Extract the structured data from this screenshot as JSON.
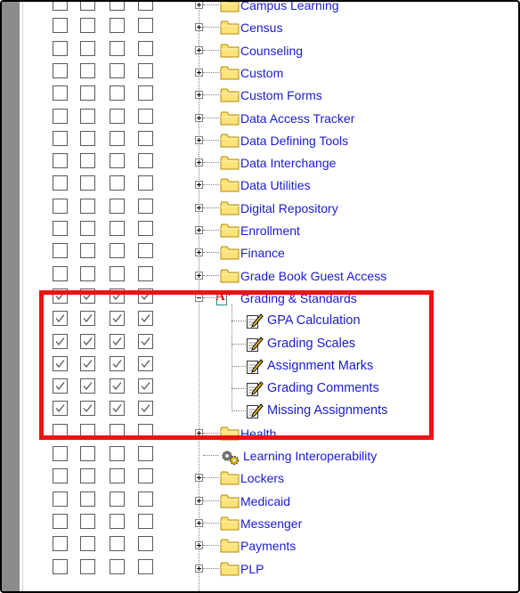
{
  "tree": {
    "rows": [
      {
        "label": "Campus Learning",
        "kind": "folder",
        "expander": "plus",
        "checked": false
      },
      {
        "label": "Census",
        "kind": "folder",
        "expander": "plus",
        "checked": false
      },
      {
        "label": "Counseling",
        "kind": "folder",
        "expander": "plus",
        "checked": false
      },
      {
        "label": "Custom",
        "kind": "folder",
        "expander": "plus",
        "checked": false
      },
      {
        "label": "Custom Forms",
        "kind": "folder",
        "expander": "plus",
        "checked": false
      },
      {
        "label": "Data Access Tracker",
        "kind": "folder",
        "expander": "plus",
        "checked": false
      },
      {
        "label": "Data Defining Tools",
        "kind": "folder",
        "expander": "plus",
        "checked": false
      },
      {
        "label": "Data Interchange",
        "kind": "folder",
        "expander": "plus",
        "checked": false
      },
      {
        "label": "Data Utilities",
        "kind": "folder",
        "expander": "plus",
        "checked": false
      },
      {
        "label": "Digital Repository",
        "kind": "folder",
        "expander": "plus",
        "checked": false
      },
      {
        "label": "Enrollment",
        "kind": "folder",
        "expander": "plus",
        "checked": false
      },
      {
        "label": "Finance",
        "kind": "folder",
        "expander": "plus",
        "checked": false
      },
      {
        "label": "Grade Book Guest Access",
        "kind": "folder",
        "expander": "plus",
        "checked": false
      },
      {
        "label": "Grading & Standards",
        "kind": "grading",
        "expander": "minus",
        "checked": true
      },
      {
        "label": "GPA Calculation",
        "kind": "tool",
        "expander": "none",
        "checked": true
      },
      {
        "label": "Grading Scales",
        "kind": "tool",
        "expander": "none",
        "checked": true
      },
      {
        "label": "Assignment Marks",
        "kind": "tool",
        "expander": "none",
        "checked": true
      },
      {
        "label": "Grading Comments",
        "kind": "tool",
        "expander": "none",
        "checked": true
      },
      {
        "label": "Missing Assignments",
        "kind": "tool",
        "expander": "none",
        "checked": true
      },
      {
        "label": "Health",
        "kind": "folder",
        "expander": "plus",
        "checked": false
      },
      {
        "label": "Learning Interoperability",
        "kind": "gears",
        "expander": "none",
        "checked": false
      },
      {
        "label": "Lockers",
        "kind": "folder",
        "expander": "plus",
        "checked": false
      },
      {
        "label": "Medicaid",
        "kind": "folder",
        "expander": "plus",
        "checked": false
      },
      {
        "label": "Messenger",
        "kind": "folder",
        "expander": "plus",
        "checked": false
      },
      {
        "label": "Payments",
        "kind": "folder",
        "expander": "plus",
        "checked": false
      },
      {
        "label": "PLP",
        "kind": "folder",
        "expander": "plus",
        "checked": false
      }
    ],
    "checkbox_columns": 4
  },
  "highlight": {
    "color": "#ee1111"
  },
  "icons": {
    "folder": "folder-icon",
    "grading": "grading-standards-icon",
    "tool": "tool-pencil-icon",
    "gears": "gears-icon",
    "checkbox": "checkbox"
  },
  "colors": {
    "label": "#1a1ad4",
    "folder_fill": "#ffe27a",
    "folder_stroke": "#b08a00",
    "gutter": "#8c8c8c"
  }
}
